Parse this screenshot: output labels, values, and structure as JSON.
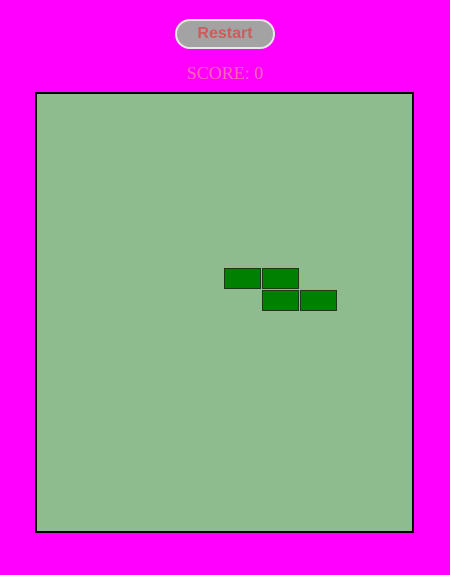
{
  "controls": {
    "restart_label": "Restart"
  },
  "score": {
    "text": "SCORE: 0",
    "value": 0
  },
  "colors": {
    "background": "#ff00ff",
    "board": "#8fbc8f",
    "board_border": "#000000",
    "piece": "#008000",
    "score_text": "#ff69b4",
    "button_bg": "#a3a3a3",
    "button_text": "#cd5c5c"
  },
  "game": {
    "active_piece": "Z-tetromino"
  }
}
